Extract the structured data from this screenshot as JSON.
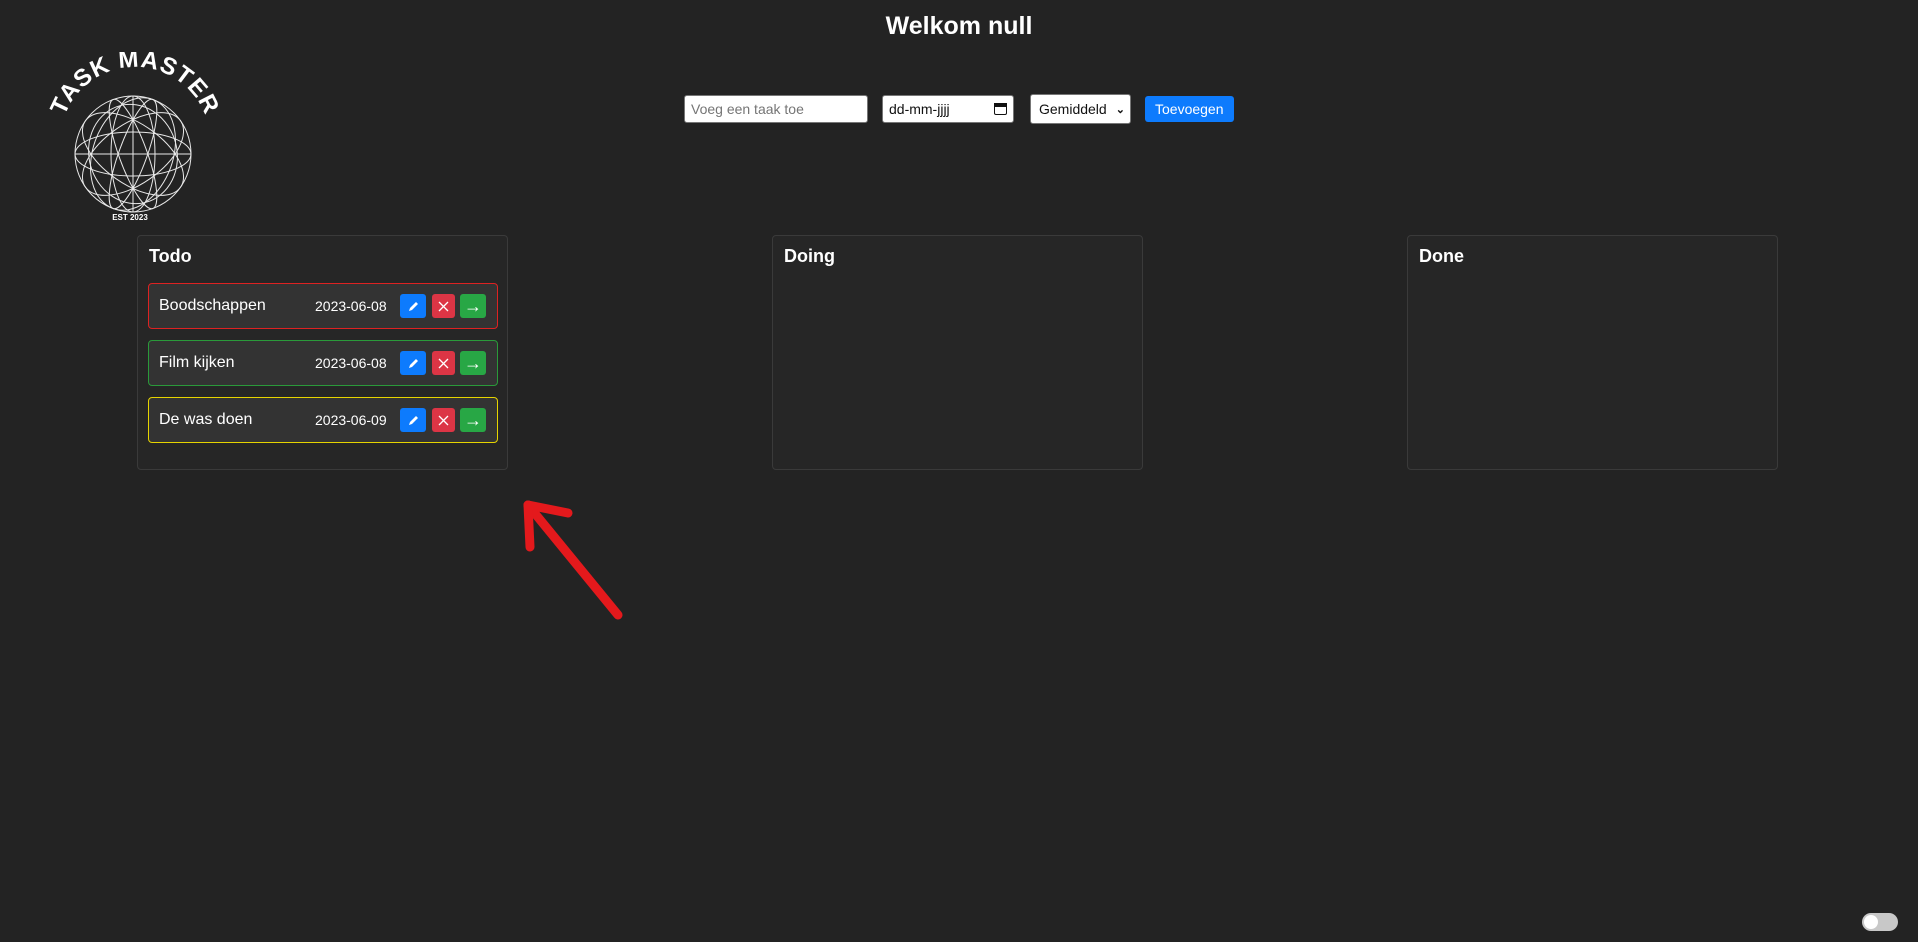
{
  "header": {
    "title": "Welkom null"
  },
  "logo": {
    "text": "TASK MASTER",
    "subtext": "EST 2023"
  },
  "form": {
    "task_placeholder": "Voeg een taak toe",
    "date_value": "dd-mm-jjjj",
    "priority_selected": "Gemiddeld",
    "add_label": "Toevoegen"
  },
  "columns": [
    {
      "title": "Todo",
      "tasks": [
        {
          "name": "Boodschappen",
          "date": "2023-06-08",
          "priority_color": "#dd2222"
        },
        {
          "name": "Film kijken",
          "date": "2023-06-08",
          "priority_color": "#2a9a3a"
        },
        {
          "name": "De was doen",
          "date": "2023-06-09",
          "priority_color": "#e6d400"
        }
      ]
    },
    {
      "title": "Doing",
      "tasks": []
    },
    {
      "title": "Done",
      "tasks": []
    }
  ],
  "task_actions": {
    "edit_icon": "pencil-icon",
    "delete_icon": "close-icon",
    "move_icon": "arrow-right-icon"
  },
  "annotation": {
    "color": "#e4191c"
  },
  "colors": {
    "background": "#232323",
    "primary": "#0d7bfd",
    "danger": "#dc3545",
    "success": "#28a745"
  }
}
